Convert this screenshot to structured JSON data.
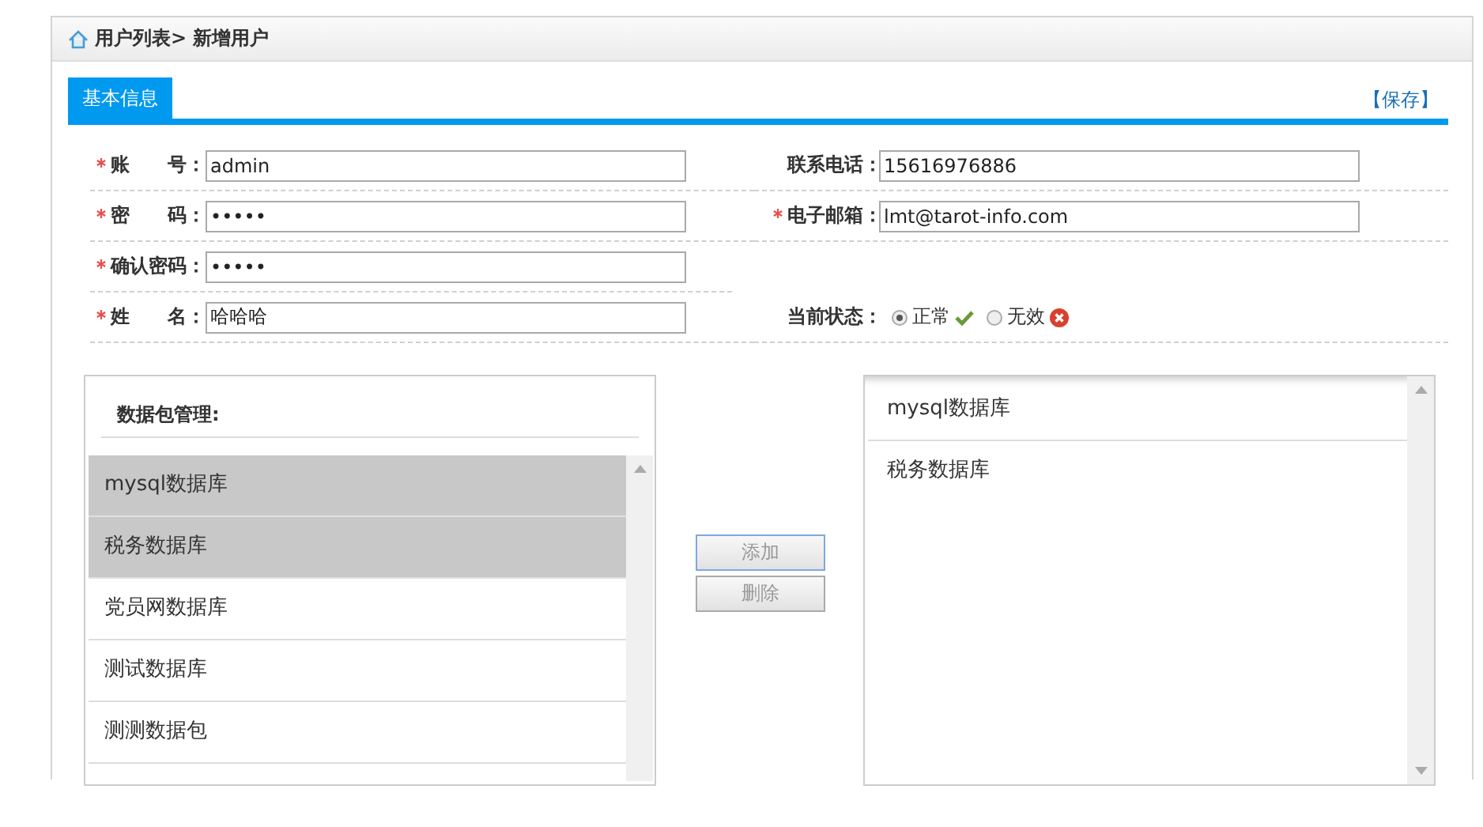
{
  "breadcrumb": "用户列表> 新增用户",
  "tabs": [
    {
      "label": "基本信息",
      "selected": true
    }
  ],
  "save_link": "【保存】",
  "rows": [
    {
      "left": {
        "kind": "input",
        "required": true,
        "label": "账　　号：",
        "value": "admin"
      },
      "right": {
        "kind": "input",
        "required": false,
        "label": "联系电话：",
        "value": "15616976886"
      }
    },
    {
      "left": {
        "kind": "input",
        "required": true,
        "label": "密　　码：",
        "value": "•••••"
      },
      "right": {
        "kind": "input",
        "required": true,
        "label": "电子邮箱：",
        "value": "lmt@tarot-info.com"
      }
    },
    {
      "left": {
        "kind": "input",
        "required": true,
        "label": "确认密码：",
        "value": "•••••"
      },
      "right": {
        "kind": "empty"
      }
    },
    {
      "left": {
        "kind": "input",
        "required": true,
        "label": "姓　　名：",
        "value": "哈哈哈"
      },
      "right": {
        "kind": "radio",
        "required": false,
        "label": "当前状态：",
        "options": [
          {
            "label": "正常",
            "selected": true
          },
          {
            "label": "无效",
            "selected": false
          }
        ]
      }
    }
  ],
  "package_list": {
    "title": "数据包管理:",
    "items": [
      {
        "label": "mysql数据库",
        "selected": true
      },
      {
        "label": "税务数据库",
        "selected": true
      },
      {
        "label": "党员网数据库",
        "selected": false
      },
      {
        "label": "测试数据库",
        "selected": false
      },
      {
        "label": "测测数据包",
        "selected": false
      }
    ]
  },
  "buttons": [
    {
      "label": "添加",
      "disabled": true,
      "focused": true
    },
    {
      "label": "删除",
      "disabled": true,
      "focused": false
    }
  ],
  "chosen_list": {
    "items": [
      {
        "label": "mysql数据库"
      },
      {
        "label": "税务数据库"
      }
    ]
  }
}
